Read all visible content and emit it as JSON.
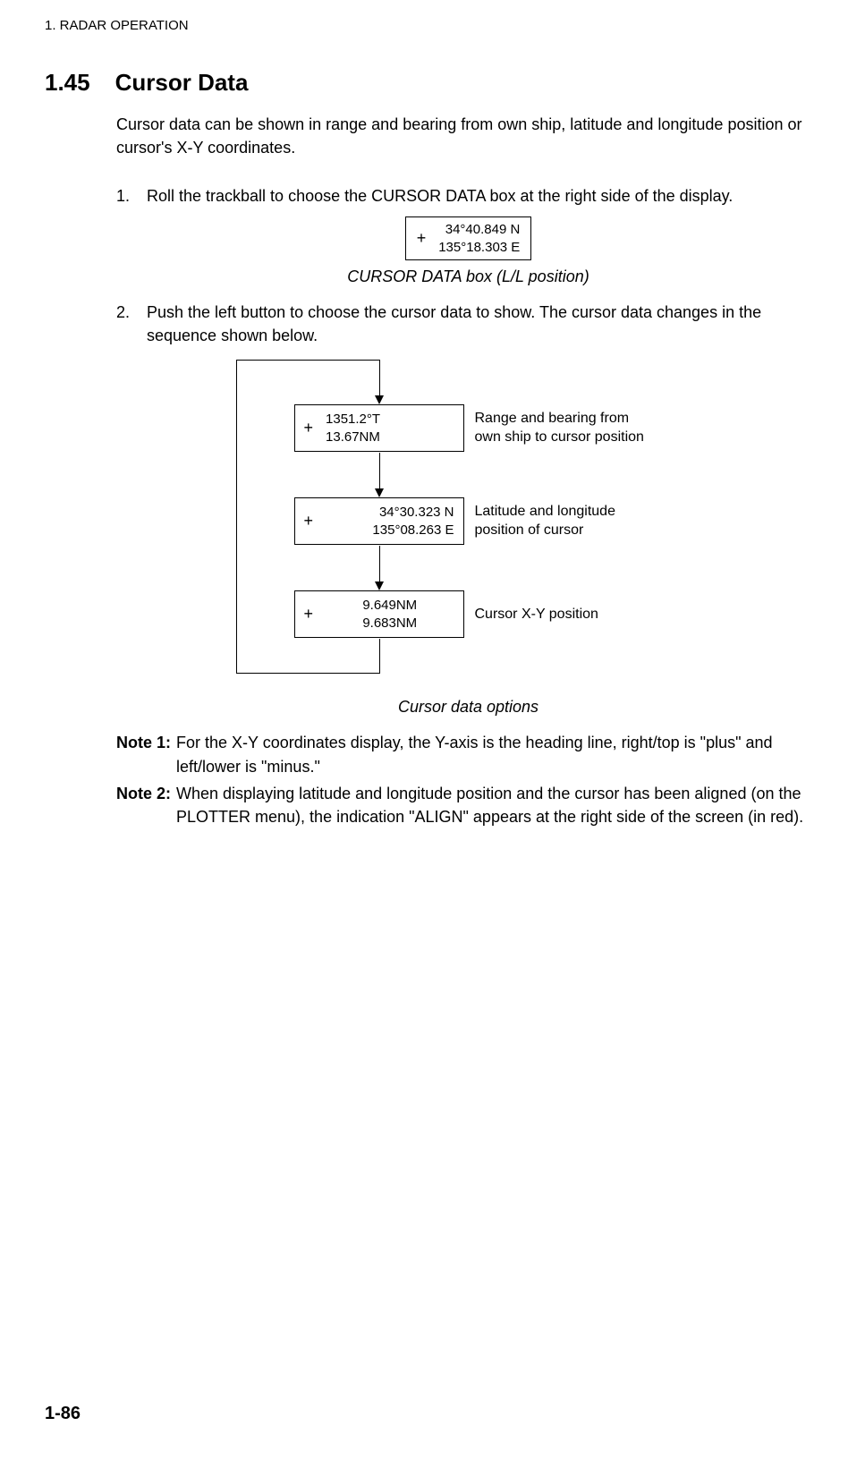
{
  "header": "1. RADAR OPERATION",
  "section": {
    "number": "1.45",
    "title": "Cursor Data"
  },
  "intro": "Cursor data can be shown in range and bearing from own ship, latitude and longitude position or cursor's X-Y coordinates.",
  "steps": {
    "s1_num": "1.",
    "s1_text": "Roll the trackball to choose the CURSOR DATA box at the right side of the display.",
    "s2_num": "2.",
    "s2_text": "Push the left button to choose the cursor data to show. The cursor data changes in the sequence shown below."
  },
  "ll_box": {
    "plus": "+",
    "line1": "34°40.849 N",
    "line2": "135°18.303 E"
  },
  "caption1": "CURSOR DATA box (L/L position)",
  "options": {
    "opt1_plus": "+",
    "opt1_line1": "1351.2°T",
    "opt1_line2": "13.67NM",
    "opt1_label_l1": "Range and bearing from",
    "opt1_label_l2": "own ship to cursor position",
    "opt2_plus": "+",
    "opt2_line1": "34°30.323 N",
    "opt2_line2": "135°08.263 E",
    "opt2_label_l1": "Latitude and longitude",
    "opt2_label_l2": "position of cursor",
    "opt3_plus": "+",
    "opt3_line1": "9.649NM",
    "opt3_line2": "9.683NM",
    "opt3_label": "Cursor X-Y position"
  },
  "caption2": "Cursor data options",
  "notes": {
    "n1_label": "Note 1:",
    "n1_text": "For the X-Y coordinates display, the Y-axis is the heading line, right/top is \"plus\" and left/lower is \"minus.\"",
    "n2_label": "Note 2:",
    "n2_text": "When displaying latitude and longitude position and the cursor has been aligned (on the PLOTTER menu), the indication \"ALIGN\" appears at the right side of the screen (in red)."
  },
  "footer": "1-86"
}
